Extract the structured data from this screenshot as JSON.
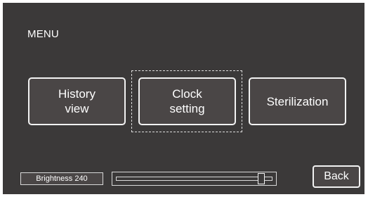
{
  "menu": {
    "title": "MENU",
    "buttons": [
      {
        "label": "History\nview"
      },
      {
        "label": "Clock\nsetting"
      },
      {
        "label": "Sterilization"
      }
    ],
    "focused_index": 1
  },
  "brightness": {
    "label": "Brightness 240",
    "value": 240,
    "max": 255
  },
  "back": {
    "label": "Back"
  },
  "colors": {
    "background": "#3b3939",
    "button_fill": "#4a4646",
    "border": "#f2f2f2",
    "text": "#ffffff"
  }
}
